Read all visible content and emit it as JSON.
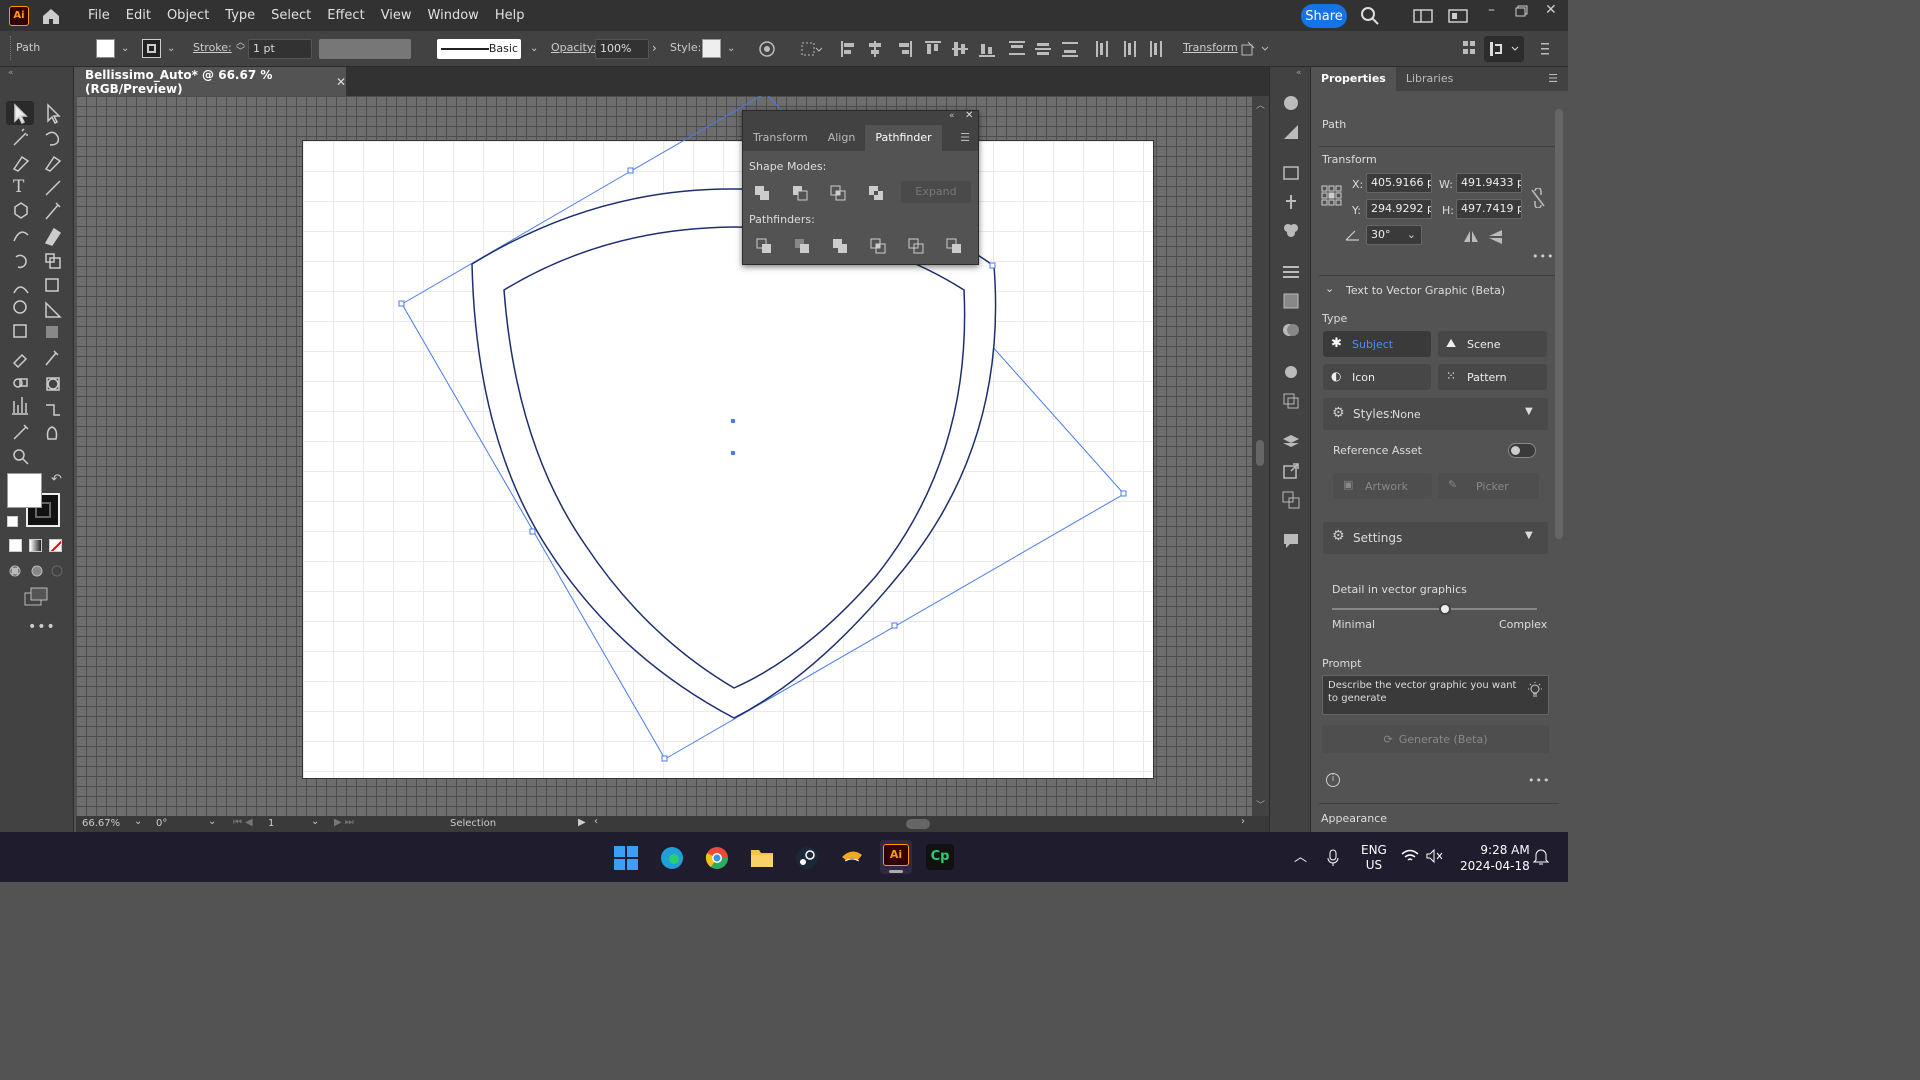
{
  "app": {
    "logo": "Ai",
    "title": "Bellissimo_Auto* @ 66.67 % (RGB/Preview)"
  },
  "menu": [
    "File",
    "Edit",
    "Object",
    "Type",
    "Select",
    "Effect",
    "View",
    "Window",
    "Help"
  ],
  "share_label": "Share",
  "control": {
    "selection_type": "Path",
    "stroke_label": "Stroke:",
    "stroke_value": "1 pt",
    "brush": "Basic",
    "opacity_label": "Opacity:",
    "opacity_value": "100%",
    "style_label": "Style:",
    "transform_label": "Transform"
  },
  "pathfinder": {
    "tabs": [
      "Transform",
      "Align",
      "Pathfinder"
    ],
    "shape_modes": "Shape Modes:",
    "expand": "Expand",
    "pathfinders": "Pathfinders:"
  },
  "status": {
    "zoom": "66.67%",
    "rotation": "0°",
    "artboard": "1",
    "tool": "Selection"
  },
  "properties": {
    "tabs": [
      "Properties",
      "Libraries"
    ],
    "object_type": "Path",
    "transform_header": "Transform",
    "x_label": "X:",
    "x_value": "405.9166 p",
    "w_label": "W:",
    "w_value": "491.9433 p",
    "y_label": "Y:",
    "y_value": "294.9292 p",
    "h_label": "H:",
    "h_value": "497.7419 p",
    "angle_value": "30°",
    "t2v_header": "Text to Vector Graphic (Beta)",
    "type_label": "Type",
    "types": [
      "Subject",
      "Scene",
      "Icon",
      "Pattern"
    ],
    "styles_label": "Styles:",
    "styles_value": "None",
    "reference_asset": "Reference Asset",
    "artwork": "Artwork",
    "picker": "Picker",
    "settings": "Settings",
    "detail_label": "Detail in vector graphics",
    "detail_level": 0.55,
    "minimal": "Minimal",
    "complex": "Complex",
    "prompt_label": "Prompt",
    "prompt_placeholder": "Describe the vector graphic you want to generate",
    "generate": "Generate (Beta)",
    "appearance": "Appearance"
  },
  "taskbar": {
    "lang": "ENG",
    "region": "US",
    "time": "9:28 AM",
    "date": "2024-04-18"
  },
  "colors": {
    "accent": "#1473e6",
    "selection": "#4a7be8",
    "shield_stroke": "#1e2f6e"
  }
}
